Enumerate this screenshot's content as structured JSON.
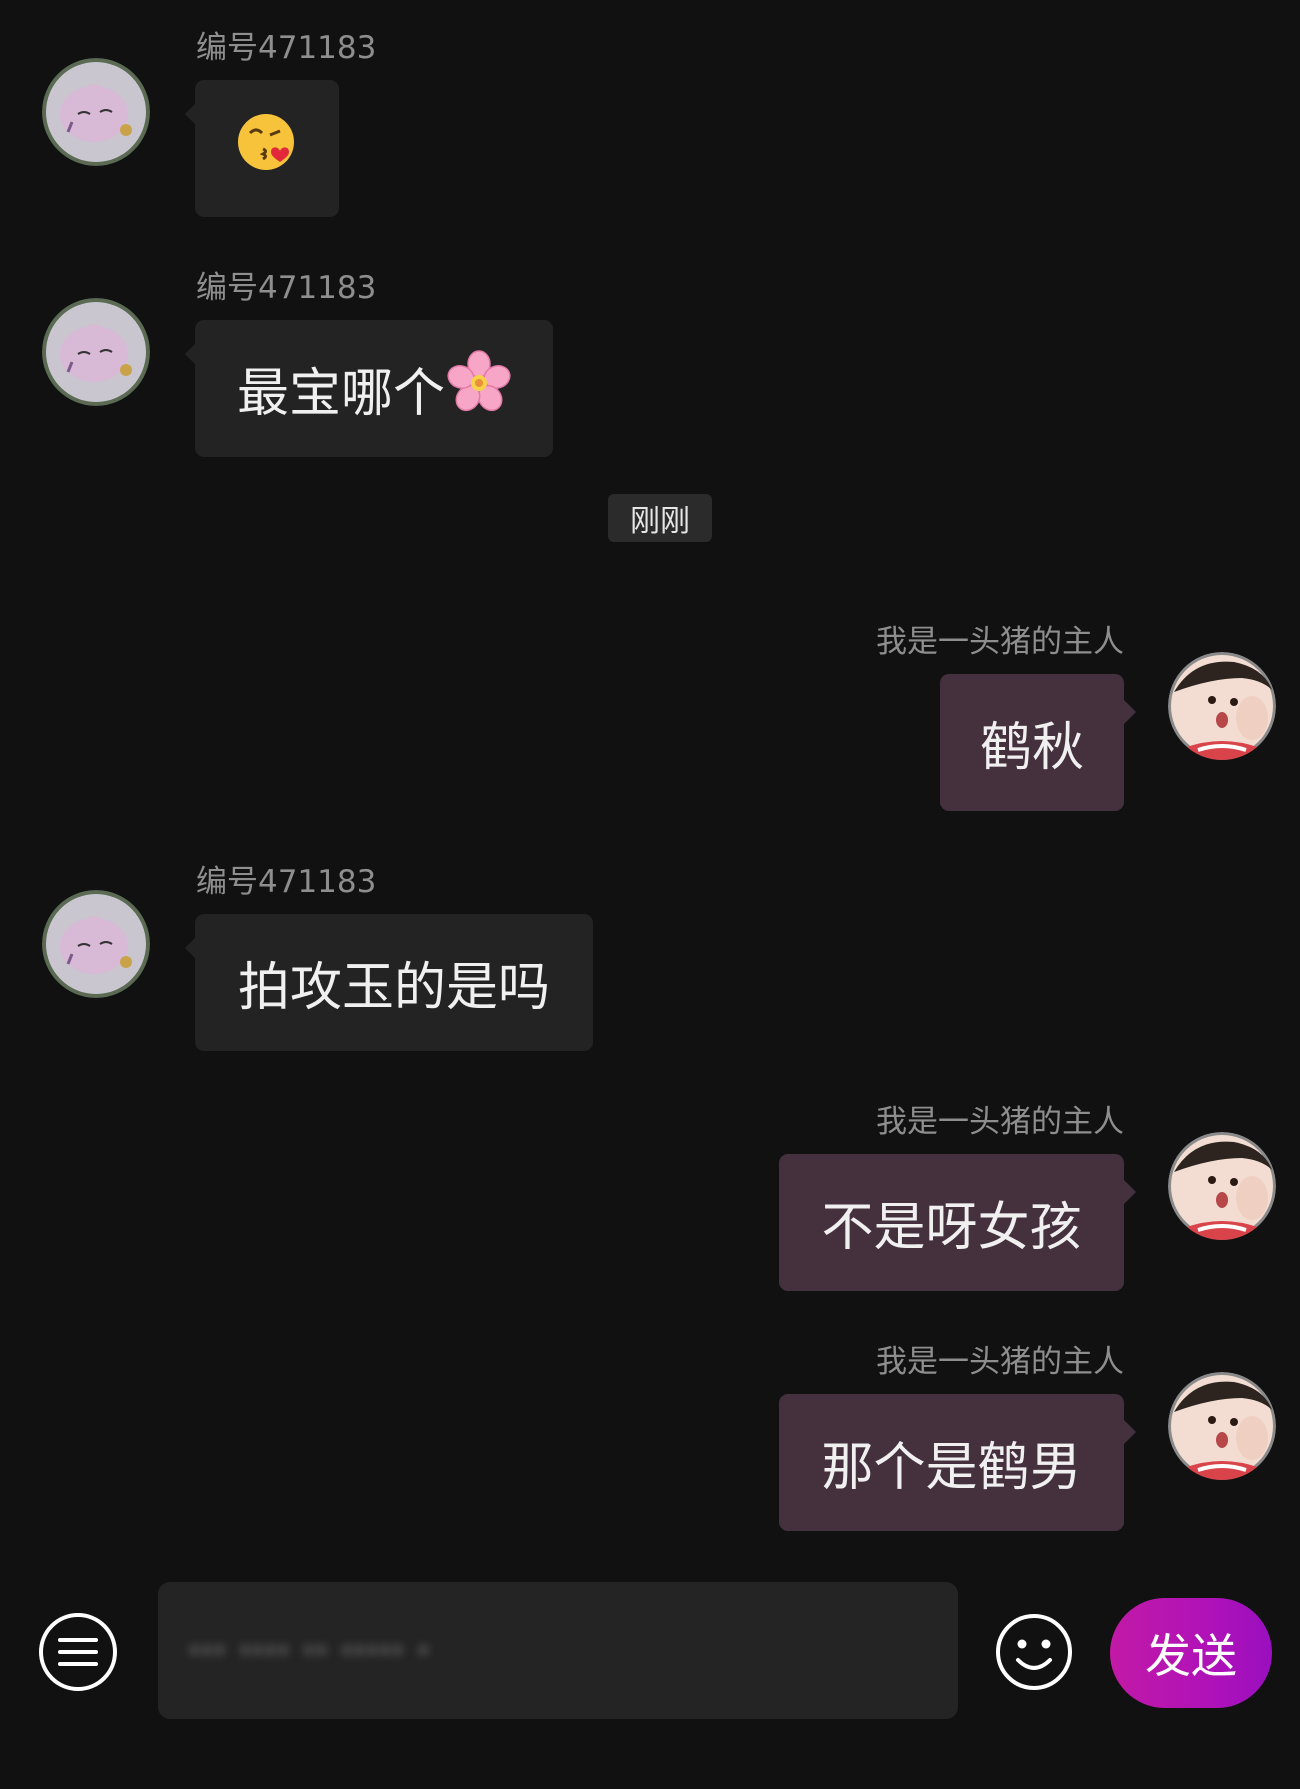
{
  "messages": [
    {
      "side": "in",
      "sender": "编号471183",
      "text": "",
      "emoji": "kissing-heart-emoji"
    },
    {
      "side": "in",
      "sender": "编号471183",
      "text": "最宝哪个",
      "emoji": "cherry-blossom-emoji"
    },
    {
      "side": "out",
      "sender": "我是一头猪的主人",
      "text": "鹤秋"
    },
    {
      "side": "in",
      "sender": "编号471183",
      "text": "拍攻玉的是吗"
    },
    {
      "side": "out",
      "sender": "我是一头猪的主人",
      "text": "不是呀女孩"
    },
    {
      "side": "out",
      "sender": "我是一头猪的主人",
      "text": "那个是鹤男"
    }
  ],
  "timestamp": "刚刚",
  "composer": {
    "input_value": "··· ···· ·· ····· ·",
    "send_label": "发送",
    "menu_icon": "menu-icon",
    "emoji_icon": "smiley-icon"
  },
  "colors": {
    "background": "#111111",
    "incoming_bubble": "#232323",
    "outgoing_bubble": "#45303d",
    "send_gradient_start": "#c21aa6",
    "send_gradient_end": "#9a0fbf"
  }
}
